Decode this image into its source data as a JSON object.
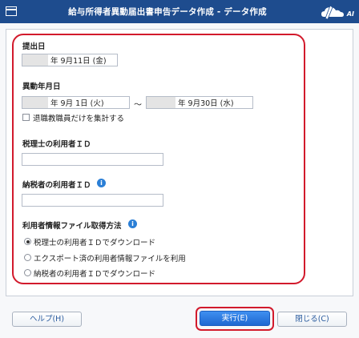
{
  "window": {
    "title": "給与所得者異動届出書申告データ作成 - データ作成",
    "brand_badge": "AI"
  },
  "form": {
    "submission_date": {
      "label": "提出日",
      "value": "年  9月11日 (金)"
    },
    "change_period": {
      "label": "異動年月日",
      "from_value": "年  9月  1日 (火)",
      "separator": "～",
      "to_value": "年  9月30日 (水)",
      "retired_only_label": "退職教職員だけを集計する",
      "retired_only_checked": false
    },
    "tax_accountant_id": {
      "label": "税理士の利用者ＩＤ",
      "value": ""
    },
    "taxpayer_id": {
      "label": "納税者の利用者ＩＤ",
      "value": ""
    },
    "user_info_method": {
      "label": "利用者情報ファイル取得方法",
      "options": [
        {
          "label": "税理士の利用者ＩＤでダウンロード",
          "checked": true
        },
        {
          "label": "エクスポート済の利用者情報ファイルを利用",
          "checked": false
        },
        {
          "label": "納税者の利用者ＩＤでダウンロード",
          "checked": false
        }
      ]
    }
  },
  "buttons": {
    "help": "ヘルプ(H)",
    "execute": "実行(E)",
    "close": "閉じる(C)"
  },
  "colors": {
    "titlebar": "#1e4c8e",
    "highlight": "#d21a2c",
    "primary_button": "#1e68d1",
    "info_icon": "#2b7fd6"
  }
}
